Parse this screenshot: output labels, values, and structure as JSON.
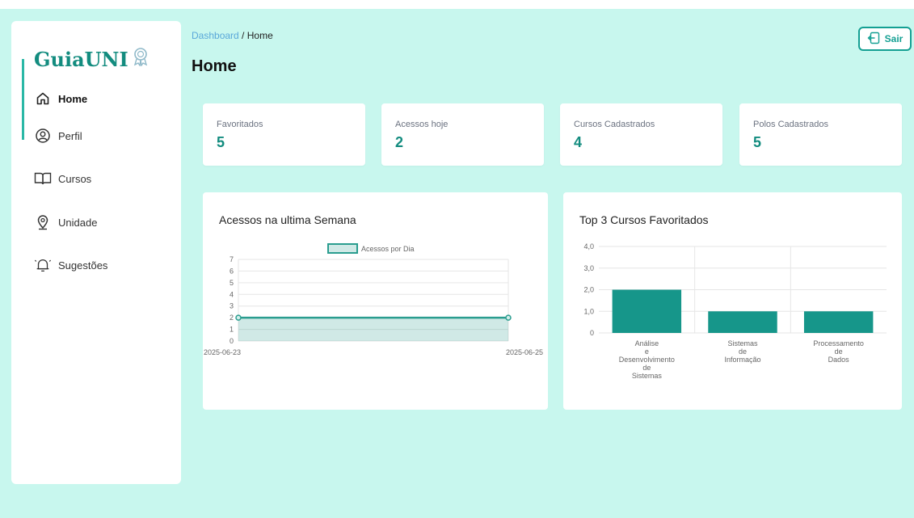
{
  "app": {
    "logo_text": "GuiaUNI",
    "logo_icon": "ribbon-award-icon"
  },
  "sidebar": {
    "items": [
      {
        "label": "Home",
        "icon": "home-icon",
        "active": true
      },
      {
        "label": "Perfil",
        "icon": "user-circle-icon",
        "active": false
      },
      {
        "label": "Cursos",
        "icon": "book-open-icon",
        "active": false
      },
      {
        "label": "Unidade",
        "icon": "map-pin-icon",
        "active": false
      },
      {
        "label": "Sugestões",
        "icon": "bell-icon",
        "active": false
      }
    ]
  },
  "header": {
    "breadcrumb_link": "Dashboard",
    "breadcrumb_sep": " / ",
    "breadcrumb_current": "Home",
    "title": "Home",
    "logout_label": "Sair",
    "logout_icon": "logout-icon"
  },
  "stats": [
    {
      "label": "Favoritados",
      "value": "5"
    },
    {
      "label": "Acessos hoje",
      "value": "2"
    },
    {
      "label": "Cursos Cadastrados",
      "value": "4"
    },
    {
      "label": "Polos Cadastrados",
      "value": "5"
    }
  ],
  "colors": {
    "accent": "#138c7f",
    "background": "#c8f7ee",
    "bar": "#16968a",
    "line": "#2a9d8f"
  },
  "chart_data": [
    {
      "type": "area",
      "title": "Acessos na ultima Semana",
      "series": [
        {
          "name": "Acessos por Dia",
          "x": [
            "2025-06-23",
            "2025-06-25"
          ],
          "values": [
            2,
            2
          ]
        }
      ],
      "ylim": [
        0,
        7
      ],
      "yticks": [
        "0",
        "1",
        "2",
        "3",
        "4",
        "5",
        "6",
        "7"
      ],
      "grid": true,
      "legend": "top-center"
    },
    {
      "type": "bar",
      "title": "Top 3 Cursos Favoritados",
      "categories": [
        [
          "Análise",
          "e",
          "Desenvolvimento",
          "de",
          "Sistemas"
        ],
        [
          "Sistemas",
          "de",
          "Informação"
        ],
        [
          "Processamento",
          "de",
          "Dados"
        ]
      ],
      "values": [
        2,
        1,
        1
      ],
      "ylim": [
        0,
        4
      ],
      "yticks": [
        "0",
        "1,0",
        "2,0",
        "3,0",
        "4,0"
      ],
      "grid": true
    }
  ]
}
